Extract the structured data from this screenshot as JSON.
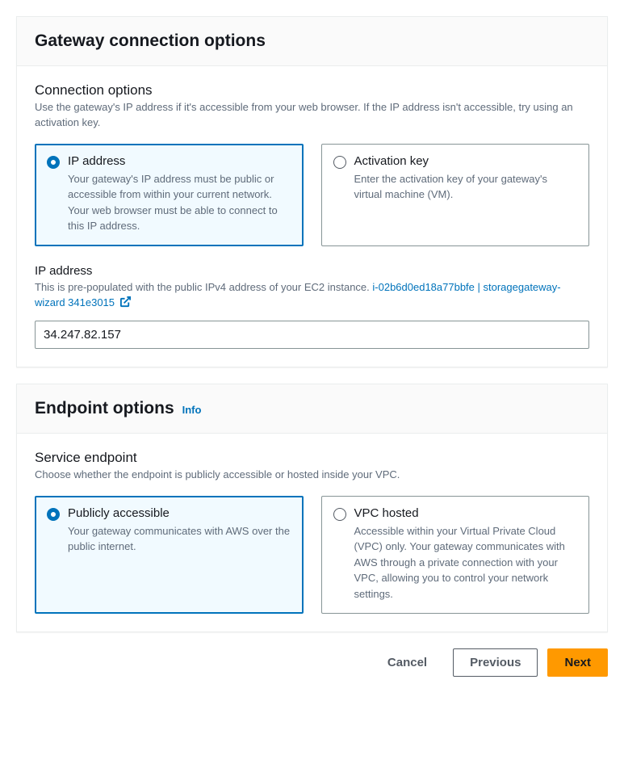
{
  "gateway_panel": {
    "title": "Gateway connection options",
    "section_title": "Connection options",
    "section_desc": "Use the gateway's IP address if it's accessible from your web browser. If the IP address isn't accessible, try using an activation key.",
    "tiles": [
      {
        "title": "IP address",
        "desc": "Your gateway's IP address must be public or accessible from within your current network. Your web browser must be able to connect to this IP address."
      },
      {
        "title": "Activation key",
        "desc": "Enter the activation key of your gateway's virtual machine (VM)."
      }
    ],
    "ip_field": {
      "label": "IP address",
      "help_prefix": "This is pre-populated with the public IPv4 address of your EC2 instance. ",
      "link_text": "i-02b6d0ed18a77bbfe | storagegateway-wizard 341e3015",
      "value": "34.247.82.157"
    }
  },
  "endpoint_panel": {
    "title": "Endpoint options",
    "info_label": "Info",
    "section_title": "Service endpoint",
    "section_desc": "Choose whether the endpoint is publicly accessible or hosted inside your VPC.",
    "tiles": [
      {
        "title": "Publicly accessible",
        "desc": "Your gateway communicates with AWS over the public internet."
      },
      {
        "title": "VPC hosted",
        "desc": "Accessible within your Virtual Private Cloud (VPC) only. Your gateway communicates with AWS through a private connection with your VPC, allowing you to control your network settings."
      }
    ]
  },
  "footer": {
    "cancel": "Cancel",
    "previous": "Previous",
    "next": "Next"
  }
}
